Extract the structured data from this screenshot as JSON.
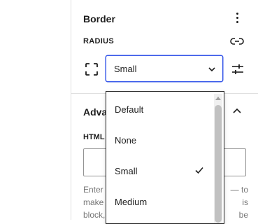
{
  "border_section": {
    "title": "Border",
    "menu_icon": "more-vertical-icon"
  },
  "radius": {
    "label": "RADIUS",
    "unlink_icon": "unlink-icon",
    "corners_icon": "corners-icon",
    "selected": "Small",
    "chevron_icon": "chevron-down-icon",
    "custom_icon": "settings-sliders-icon"
  },
  "dropdown": {
    "options": [
      {
        "label": "Default",
        "selected": false
      },
      {
        "label": "None",
        "selected": false
      },
      {
        "label": "Small",
        "selected": true
      },
      {
        "label": "Medium",
        "selected": false
      }
    ],
    "check_icon": "check-icon"
  },
  "advanced": {
    "title_visible": "Adva",
    "chevron_icon": "chevron-up-icon",
    "html_label_visible": "HTML",
    "help_lines": [
      "Enter",
      "make",
      "block,"
    ],
    "help_lines_right": [
      "— to",
      "is",
      "be"
    ]
  },
  "colors": {
    "accent": "#3858e9",
    "text": "#1e1e1e",
    "muted": "#757575",
    "border": "#e0e0e0"
  }
}
